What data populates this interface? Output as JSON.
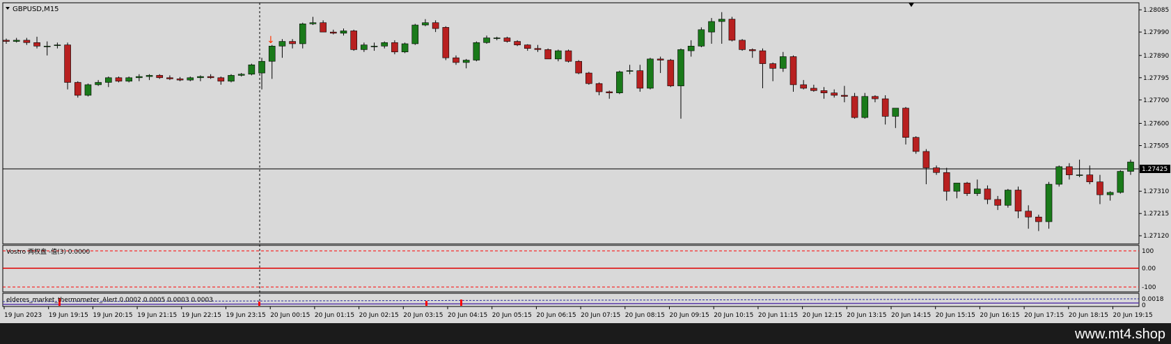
{
  "symbol_label": "GBPUSD,M15",
  "current_price": "1.27425",
  "price_ticks": [
    "1.28085",
    "1.27990",
    "1.27890",
    "1.27795",
    "1.27700",
    "1.27600",
    "1.27505",
    "1.27310",
    "1.27215",
    "1.27120"
  ],
  "indicator1_label": "Vostro 两权盘 -值(3) 0.0000",
  "indicator1_ticks": [
    "100",
    "0.00",
    "-100"
  ],
  "indicator2_label": "elderes_market_thermometer_Alert 0.0002 0.0005 0.0003 0.0003",
  "indicator2_ticks": [
    "0.0018",
    "0"
  ],
  "time_labels": [
    "19 Jun 2023",
    "19 Jun 19:15",
    "19 Jun 20:15",
    "19 Jun 21:15",
    "19 Jun 22:15",
    "19 Jun 23:15",
    "20 Jun 00:15",
    "20 Jun 01:15",
    "20 Jun 02:15",
    "20 Jun 03:15",
    "20 Jun 04:15",
    "20 Jun 05:15",
    "20 Jun 06:15",
    "20 Jun 07:15",
    "20 Jun 08:15",
    "20 Jun 09:15",
    "20 Jun 10:15",
    "20 Jun 11:15",
    "20 Jun 12:15",
    "20 Jun 13:15",
    "20 Jun 14:15",
    "20 Jun 15:15",
    "20 Jun 16:15",
    "20 Jun 17:15",
    "20 Jun 18:15",
    "20 Jun 19:15"
  ],
  "watermark": "www.mt4.shop",
  "colors": {
    "bull": "#1a7a1a",
    "bear": "#b82020",
    "background": "#d9d9d9",
    "indicator_line": "#ff0000",
    "thermo": "#2a2a9a"
  },
  "chart_data": {
    "type": "candlestick",
    "title": "GBPUSD,M15",
    "price_range": [
      1.27085,
      1.28115
    ],
    "candles": [
      [
        1.27955,
        1.27962,
        1.2794,
        1.2795
      ],
      [
        1.2795,
        1.27965,
        1.27945,
        1.27955
      ],
      [
        1.27955,
        1.27965,
        1.27935,
        1.27945
      ],
      [
        1.27945,
        1.2797,
        1.2792,
        1.2793
      ],
      [
        1.2793,
        1.2795,
        1.2789,
        1.2793
      ],
      [
        1.27935,
        1.27945,
        1.2792,
        1.27935
      ],
      [
        1.27935,
        1.27945,
        1.27745,
        1.27775
      ],
      [
        1.27775,
        1.2778,
        1.2771,
        1.2772
      ],
      [
        1.2772,
        1.2777,
        1.27715,
        1.27765
      ],
      [
        1.27765,
        1.27785,
        1.2776,
        1.27775
      ],
      [
        1.27775,
        1.278,
        1.27755,
        1.27795
      ],
      [
        1.27795,
        1.278,
        1.27775,
        1.2778
      ],
      [
        1.2778,
        1.278,
        1.27775,
        1.27795
      ],
      [
        1.27795,
        1.2781,
        1.2778,
        1.278
      ],
      [
        1.278,
        1.2781,
        1.27785,
        1.27805
      ],
      [
        1.27805,
        1.2781,
        1.2779,
        1.27795
      ],
      [
        1.27795,
        1.27805,
        1.27785,
        1.2779
      ],
      [
        1.2779,
        1.27798,
        1.2778,
        1.27785
      ],
      [
        1.27785,
        1.278,
        1.2778,
        1.27795
      ],
      [
        1.27795,
        1.27805,
        1.2778,
        1.278
      ],
      [
        1.278,
        1.2781,
        1.2779,
        1.27795
      ],
      [
        1.27795,
        1.278,
        1.27765,
        1.2778
      ],
      [
        1.2778,
        1.2781,
        1.27775,
        1.27805
      ],
      [
        1.27805,
        1.27815,
        1.278,
        1.2781
      ],
      [
        1.2781,
        1.27855,
        1.27805,
        1.2785
      ],
      [
        1.27815,
        1.2788,
        1.27745,
        1.27865
      ],
      [
        1.27865,
        1.27935,
        1.2779,
        1.2793
      ],
      [
        1.2793,
        1.2796,
        1.2788,
        1.2795
      ],
      [
        1.2795,
        1.2796,
        1.2792,
        1.2794
      ],
      [
        1.2794,
        1.2803,
        1.2792,
        1.28025
      ],
      [
        1.28025,
        1.28055,
        1.2802,
        1.2803
      ],
      [
        1.2803,
        1.2804,
        1.2799,
        1.2799
      ],
      [
        1.2799,
        1.28,
        1.2798,
        1.27985
      ],
      [
        1.27985,
        1.28005,
        1.27975,
        1.27995
      ],
      [
        1.27995,
        1.28,
        1.2791,
        1.27915
      ],
      [
        1.27915,
        1.27945,
        1.27905,
        1.27935
      ],
      [
        1.2793,
        1.27945,
        1.2791,
        1.2793
      ],
      [
        1.2793,
        1.2795,
        1.2792,
        1.27945
      ],
      [
        1.27945,
        1.27955,
        1.27895,
        1.27905
      ],
      [
        1.27905,
        1.27945,
        1.279,
        1.2794
      ],
      [
        1.2794,
        1.28025,
        1.27935,
        1.2802
      ],
      [
        1.2802,
        1.28045,
        1.28015,
        1.2803
      ],
      [
        1.2803,
        1.2804,
        1.2799,
        1.28005
      ],
      [
        1.2801,
        1.28015,
        1.2787,
        1.2788
      ],
      [
        1.2788,
        1.2789,
        1.2785,
        1.2786
      ],
      [
        1.2786,
        1.27875,
        1.27835,
        1.2787
      ],
      [
        1.2787,
        1.2795,
        1.27865,
        1.27945
      ],
      [
        1.27945,
        1.27975,
        1.2794,
        1.27965
      ],
      [
        1.27965,
        1.2797,
        1.27955,
        1.27965
      ],
      [
        1.27965,
        1.2797,
        1.27945,
        1.2795
      ],
      [
        1.2795,
        1.27955,
        1.2793,
        1.27935
      ],
      [
        1.27935,
        1.27938,
        1.2791,
        1.2792
      ],
      [
        1.2792,
        1.27935,
        1.27905,
        1.27915
      ],
      [
        1.27915,
        1.2792,
        1.27875,
        1.27875
      ],
      [
        1.27875,
        1.27915,
        1.27865,
        1.2791
      ],
      [
        1.2791,
        1.27915,
        1.2786,
        1.27865
      ],
      [
        1.27865,
        1.2787,
        1.2781,
        1.27815
      ],
      [
        1.27815,
        1.2782,
        1.27765,
        1.2777
      ],
      [
        1.2777,
        1.27775,
        1.2772,
        1.27735
      ],
      [
        1.27735,
        1.2774,
        1.27705,
        1.2773
      ],
      [
        1.2773,
        1.27825,
        1.27725,
        1.2782
      ],
      [
        1.27825,
        1.2785,
        1.2781,
        1.27825
      ],
      [
        1.27825,
        1.2785,
        1.27735,
        1.2775
      ],
      [
        1.2775,
        1.2788,
        1.27745,
        1.27875
      ],
      [
        1.27875,
        1.27885,
        1.27815,
        1.2787
      ],
      [
        1.2787,
        1.27875,
        1.27755,
        1.2776
      ],
      [
        1.2776,
        1.2792,
        1.2762,
        1.27915
      ],
      [
        1.2791,
        1.27955,
        1.27885,
        1.2793
      ],
      [
        1.2793,
        1.2801,
        1.27925,
        1.28
      ],
      [
        1.2799,
        1.2805,
        1.2794,
        1.28035
      ],
      [
        1.28035,
        1.28075,
        1.2794,
        1.28045
      ],
      [
        1.28045,
        1.28055,
        1.2795,
        1.27955
      ],
      [
        1.27955,
        1.2796,
        1.2791,
        1.27915
      ],
      [
        1.27915,
        1.2792,
        1.2788,
        1.2791
      ],
      [
        1.2791,
        1.2792,
        1.2775,
        1.27855
      ],
      [
        1.27855,
        1.2786,
        1.2778,
        1.27835
      ],
      [
        1.27835,
        1.27905,
        1.2782,
        1.27885
      ],
      [
        1.27885,
        1.2789,
        1.27735,
        1.27765
      ],
      [
        1.27765,
        1.27785,
        1.27745,
        1.2775
      ],
      [
        1.2775,
        1.27765,
        1.27735,
        1.2774
      ],
      [
        1.2774,
        1.27755,
        1.27705,
        1.2773
      ],
      [
        1.2773,
        1.27745,
        1.2771,
        1.2772
      ],
      [
        1.2772,
        1.2776,
        1.2769,
        1.27715
      ],
      [
        1.27715,
        1.2773,
        1.2762,
        1.27625
      ],
      [
        1.27625,
        1.2773,
        1.2762,
        1.27715
      ],
      [
        1.27715,
        1.2772,
        1.2769,
        1.27705
      ],
      [
        1.27705,
        1.2772,
        1.27595,
        1.2763
      ],
      [
        1.2763,
        1.2766,
        1.2758,
        1.27665
      ],
      [
        1.27665,
        1.2767,
        1.2751,
        1.2754
      ],
      [
        1.2754,
        1.27545,
        1.2747,
        1.2748
      ],
      [
        1.2748,
        1.2749,
        1.2734,
        1.2741
      ],
      [
        1.2741,
        1.2742,
        1.2738,
        1.2739
      ],
      [
        1.2739,
        1.2741,
        1.2727,
        1.2731
      ],
      [
        1.2731,
        1.27325,
        1.2728,
        1.27345
      ],
      [
        1.27345,
        1.2735,
        1.2729,
        1.273
      ],
      [
        1.273,
        1.2736,
        1.2729,
        1.2732
      ],
      [
        1.2732,
        1.27335,
        1.27255,
        1.27275
      ],
      [
        1.27275,
        1.2729,
        1.2723,
        1.2725
      ],
      [
        1.2725,
        1.2732,
        1.2724,
        1.27315
      ],
      [
        1.27315,
        1.2733,
        1.27195,
        1.27225
      ],
      [
        1.27225,
        1.2725,
        1.2715,
        1.272
      ],
      [
        1.272,
        1.2721,
        1.2714,
        1.2718
      ],
      [
        1.2718,
        1.2735,
        1.2715,
        1.2734
      ],
      [
        1.2734,
        1.2742,
        1.2733,
        1.27415
      ],
      [
        1.27415,
        1.2743,
        1.2736,
        1.2738
      ],
      [
        1.2738,
        1.27445,
        1.2737,
        1.2738
      ],
      [
        1.2738,
        1.2742,
        1.2734,
        1.2735
      ],
      [
        1.2735,
        1.2738,
        1.27255,
        1.27295
      ],
      [
        1.27295,
        1.2731,
        1.2727,
        1.27305
      ],
      [
        1.27305,
        1.274,
        1.273,
        1.27395
      ],
      [
        1.27395,
        1.27445,
        1.2738,
        1.27435
      ]
    ]
  }
}
